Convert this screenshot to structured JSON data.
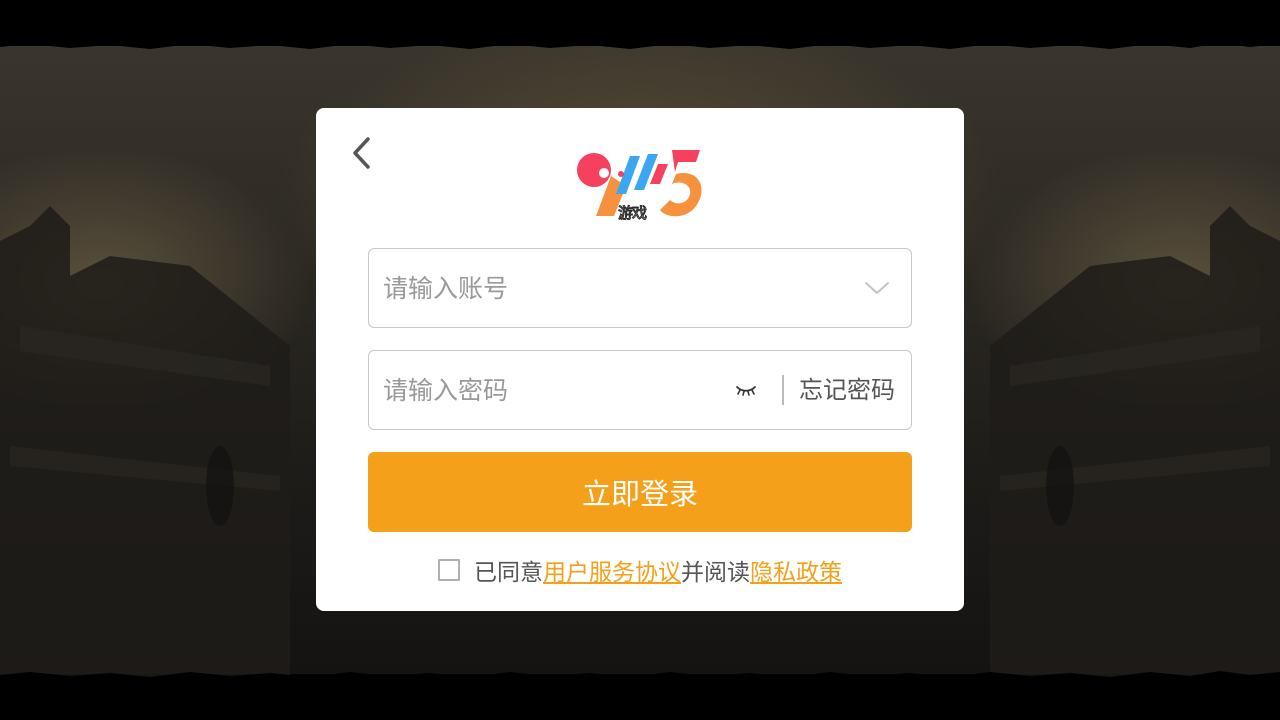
{
  "brand": {
    "logo_text": "游戏",
    "logo_colors": {
      "red": "#f5405e",
      "blue": "#3aa7f0",
      "orange": "#f6923e"
    }
  },
  "login": {
    "account_placeholder": "请输入账号",
    "password_placeholder": "请输入密码",
    "forgot_password": "忘记密码",
    "submit_label": "立即登录",
    "agreement": {
      "prefix": "已同意",
      "user_agreement": "用户服务协议",
      "middle": "并阅读",
      "privacy_policy": "隐私政策",
      "checked": false
    }
  },
  "icons": {
    "back": "back-chevron-icon",
    "dropdown": "chevron-down-icon",
    "password_toggle": "eye-closed-icon"
  },
  "colors": {
    "accent": "#f4a01a",
    "dialog_bg": "#ffffff",
    "placeholder": "#999999"
  }
}
